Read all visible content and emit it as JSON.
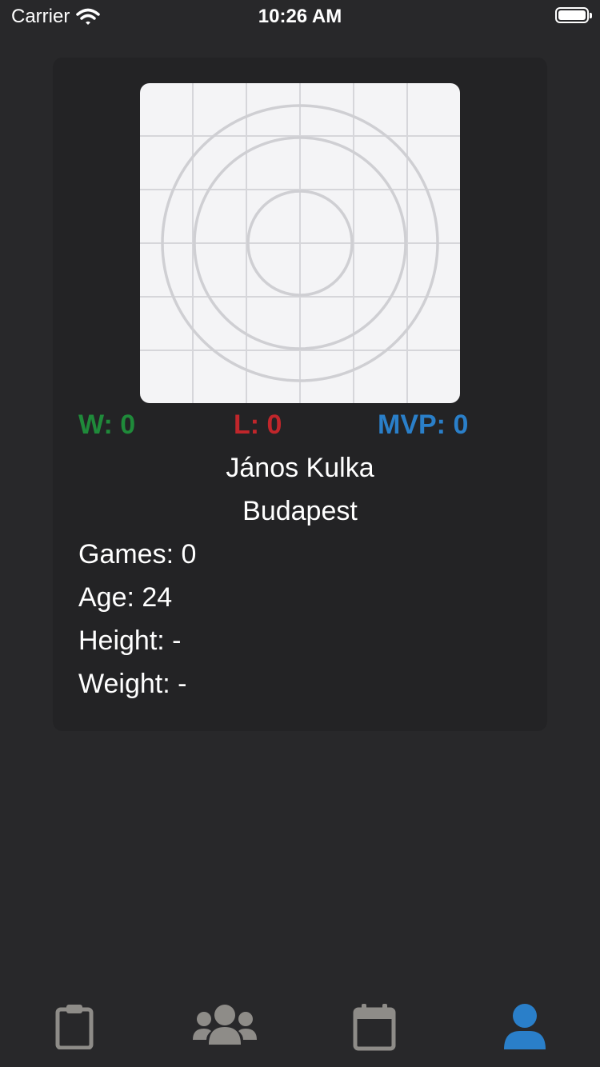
{
  "status_bar": {
    "carrier": "Carrier",
    "time": "10:26 AM"
  },
  "profile": {
    "photo_icon": "placeholder-image",
    "wins": "W: 0",
    "losses": "L: 0",
    "mvp": "MVP: 0",
    "name": "János Kulka",
    "city": "Budapest",
    "games": "Games: 0",
    "age": "Age: 24",
    "height": "Height: -",
    "weight": "Weight: -"
  },
  "colors": {
    "wins": "#1f8a3a",
    "losses": "#c0262b",
    "mvp": "#2a7fc9",
    "tab_inactive": "#8e8c88",
    "tab_active": "#2a7fc9",
    "background": "#28282a",
    "card": "#232325"
  },
  "tab_bar": {
    "items": [
      {
        "icon": "clipboard-icon",
        "active": false
      },
      {
        "icon": "users-icon",
        "active": false
      },
      {
        "icon": "calendar-icon",
        "active": false
      },
      {
        "icon": "user-icon",
        "active": true
      }
    ]
  }
}
